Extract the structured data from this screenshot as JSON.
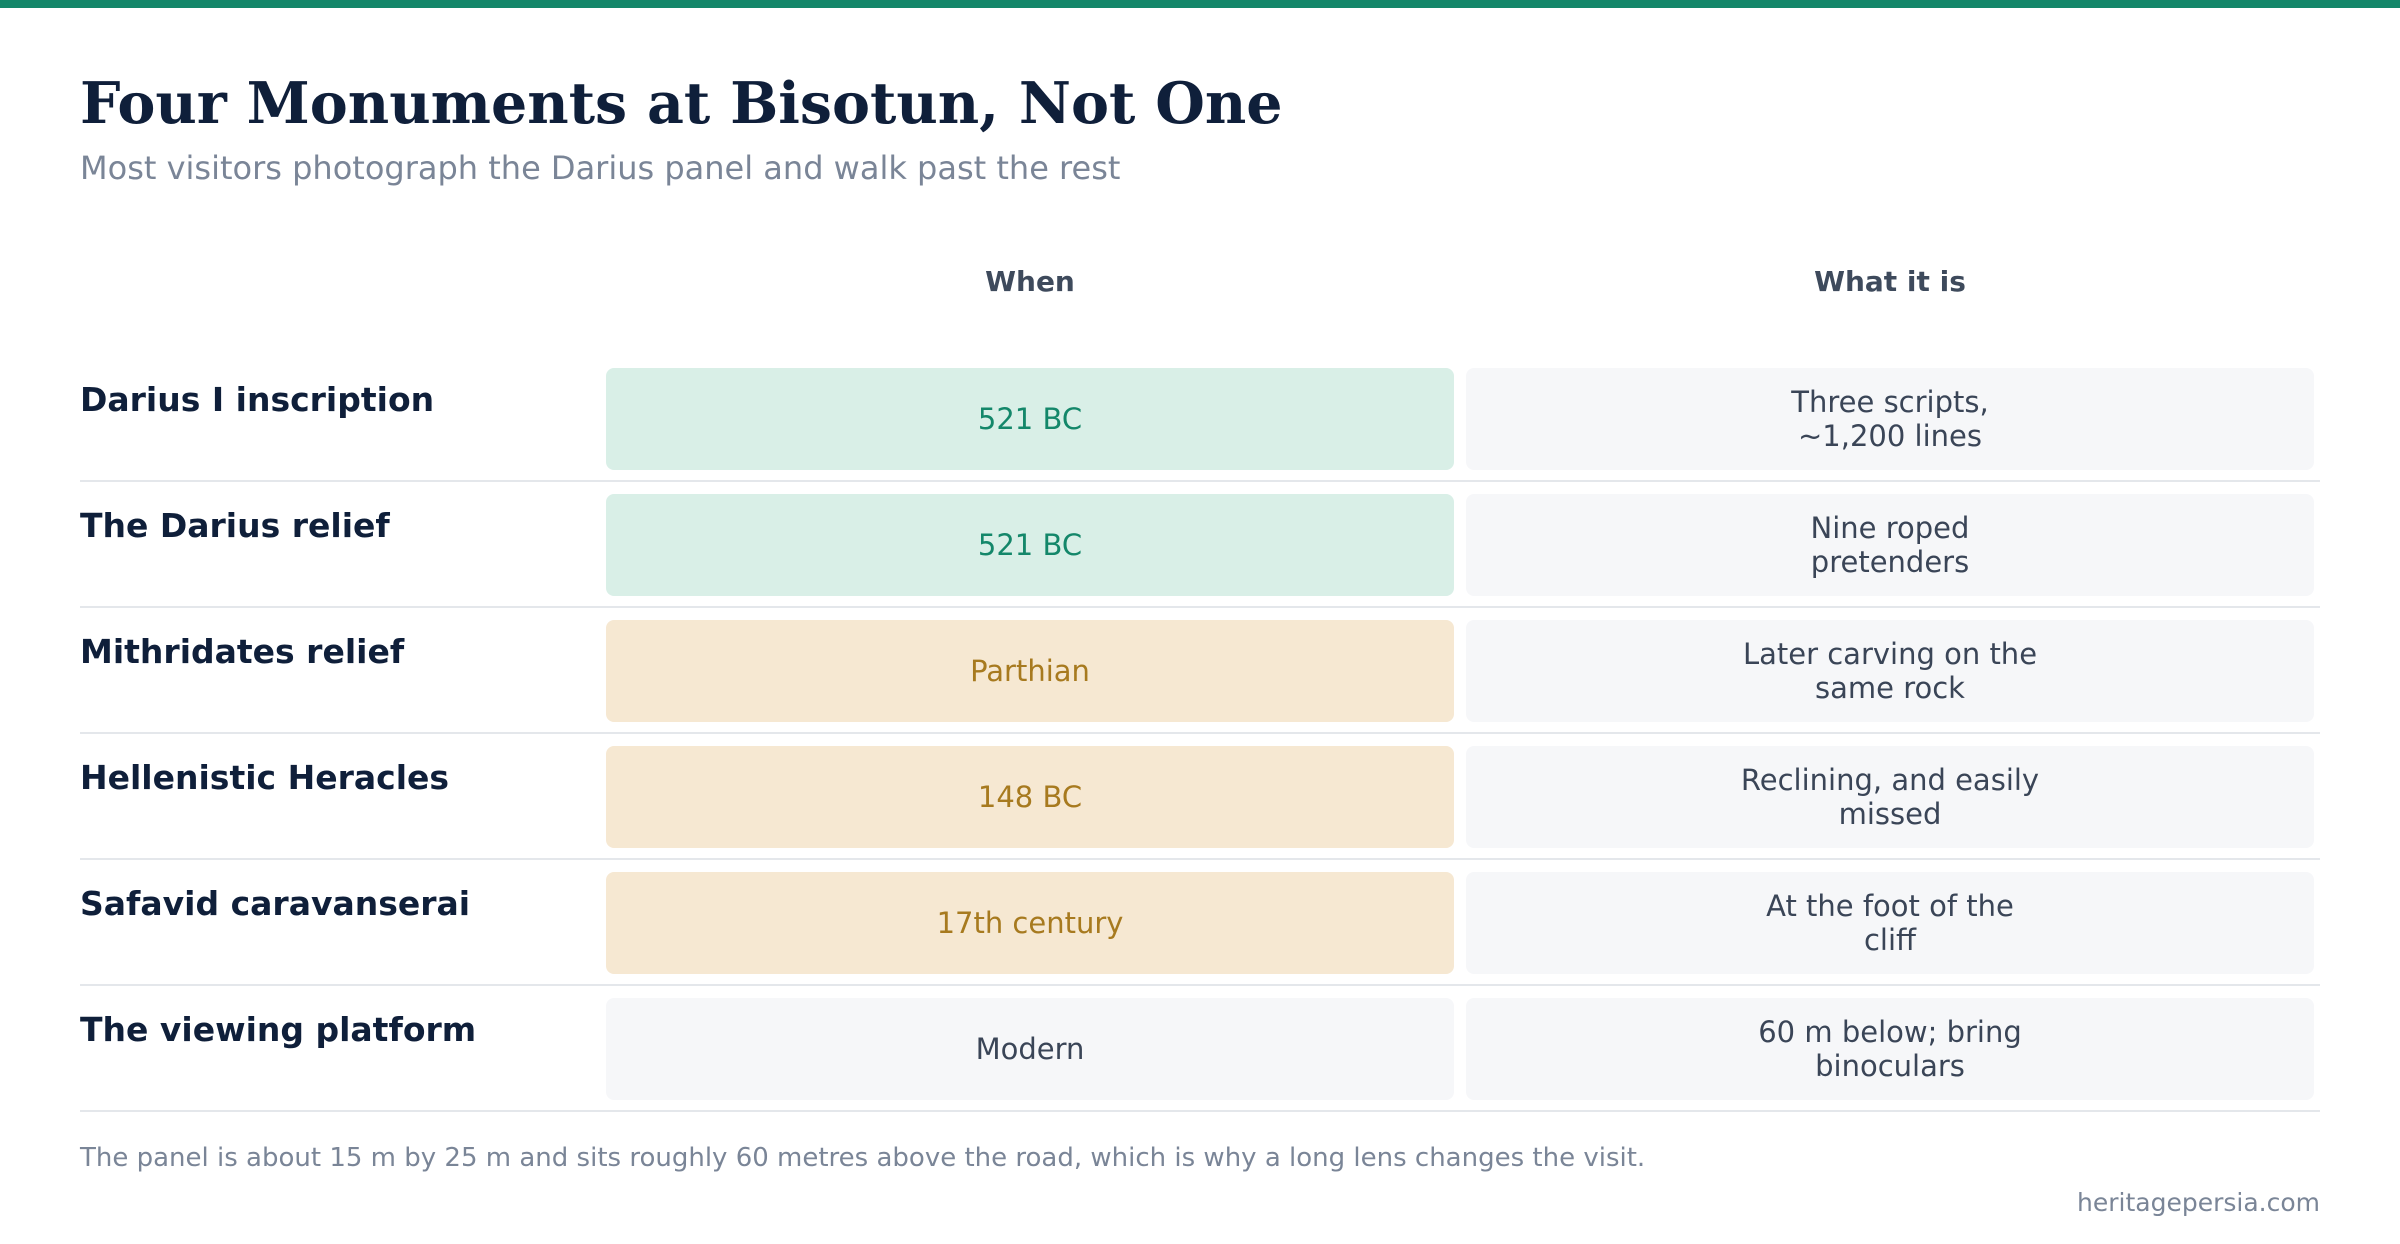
{
  "colors": {
    "accent": "#14876a",
    "title": "#0f1f3a",
    "muted": "#7a8597",
    "green_bg": "#d9efe7",
    "green_text": "#14876a",
    "amber_bg": "#f6e8d2",
    "amber_text": "#a77a1f",
    "neutral_bg": "#f6f7f9",
    "neutral_text": "#3a4557"
  },
  "header": {
    "title": "Four Monuments at Bisotun, Not One",
    "subtitle": "Most visitors photograph the Darius panel and walk past the rest"
  },
  "table": {
    "columns": [
      "When",
      "What it is"
    ],
    "rows": [
      {
        "label": "Darius I inscription",
        "when": "521 BC",
        "when_tone": "green",
        "what": "Three scripts, ~1,200 lines"
      },
      {
        "label": "The Darius relief",
        "when": "521 BC",
        "when_tone": "green",
        "what": "Nine roped pretenders"
      },
      {
        "label": "Mithridates relief",
        "when": "Parthian",
        "when_tone": "amber",
        "what": "Later carving on the same rock"
      },
      {
        "label": "Hellenistic Heracles",
        "when": "148 BC",
        "when_tone": "amber",
        "what": "Reclining, and easily missed"
      },
      {
        "label": "Safavid caravanserai",
        "when": "17th century",
        "when_tone": "amber",
        "what": "At the foot of the cliff"
      },
      {
        "label": "The viewing platform",
        "when": "Modern",
        "when_tone": "neutral",
        "what": "60 m below; bring binoculars"
      }
    ]
  },
  "footer": {
    "note": "The panel is about 15 m by 25 m and sits roughly 60 metres above the road, which is why a long lens changes the visit.",
    "source": "heritagepersia.com"
  }
}
